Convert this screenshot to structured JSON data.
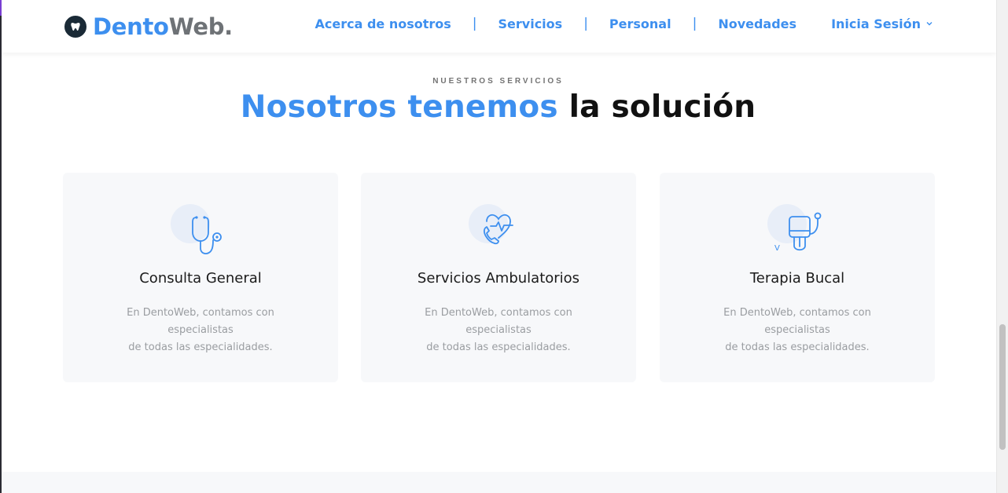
{
  "header": {
    "logo": {
      "part1": "Dento",
      "part2": "Web."
    },
    "nav": [
      {
        "label": "Acerca de nosotros"
      },
      {
        "label": "Servicios"
      },
      {
        "label": "Personal"
      },
      {
        "label": "Novedades"
      }
    ],
    "separator": "|",
    "login_label": "Inicia Sesión"
  },
  "section": {
    "eyebrow": "NUESTROS SERVICIOS",
    "headline_blue": "Nosotros tenemos",
    "headline_dark": "la solución"
  },
  "cards": [
    {
      "icon": "stethoscope-icon",
      "title": "Consulta General",
      "desc_line1": "En DentoWeb, contamos con especialistas",
      "desc_line2": "de todas las especialidades."
    },
    {
      "icon": "heart-phone-icon",
      "title": "Servicios Ambulatorios",
      "desc_line1": "En DentoWeb, contamos con especialistas",
      "desc_line2": "de todas las especialidades."
    },
    {
      "icon": "blood-pressure-icon",
      "title": "Terapia Bucal",
      "desc_line1": "En DentoWeb, contamos con especialistas",
      "desc_line2": "de todas las especialidades.",
      "icon_mark": "V"
    }
  ],
  "colors": {
    "brand_blue": "#3d8fef",
    "logo_gray": "#6e7276",
    "card_bg": "#f7f8fa",
    "icon_circle": "#e8eef8"
  }
}
